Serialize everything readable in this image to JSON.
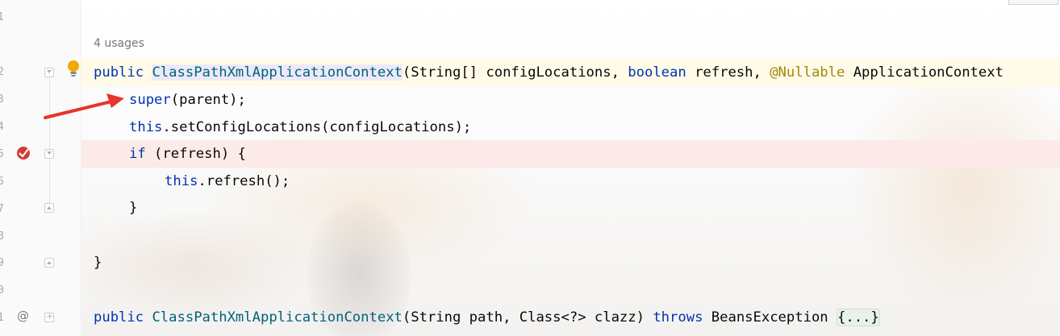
{
  "editor": {
    "usages_hint": "4 usages",
    "line_numbers": [
      "1",
      "2",
      "3",
      "4",
      "5",
      "6",
      "7",
      "8",
      "9",
      "0",
      "1"
    ],
    "code": {
      "l2": {
        "kw1": "public",
        "cls": "ClassPathXmlApplicationContext",
        "p1": "(String[] configLocations, ",
        "kw2": "boolean",
        "p2": " refresh, ",
        "ann": "@Nullable",
        "p3": " ApplicationContext"
      },
      "l3": {
        "kw": "super",
        "rest": "(parent);"
      },
      "l4": {
        "kw": "this",
        "rest": ".setConfigLocations(configLocations);"
      },
      "l5": {
        "kw": "if",
        "rest": " (refresh) {"
      },
      "l6": {
        "kw": "this",
        "rest": ".refresh();"
      },
      "l7": {
        "text": "}"
      },
      "l9": {
        "text": "}"
      },
      "l11": {
        "kw1": "public",
        "cls": "ClassPathXmlApplicationContext",
        "p1": "(String path, Class<?> clazz) ",
        "kw2": "throws",
        "p2": " BeansException ",
        "folded": "{...}"
      }
    },
    "gutter_icons": {
      "l2": "lightbulb-icon",
      "l5": "breakpoint-icon",
      "l11": "at-icon",
      "at_symbol": "@"
    },
    "colors": {
      "keyword": "#0033b3",
      "class": "#00627a",
      "annotation": "#9e880d",
      "breakpoint_row": "#fae9e7",
      "caret_row": "#fffae3",
      "arrow": "#e8342a"
    }
  }
}
